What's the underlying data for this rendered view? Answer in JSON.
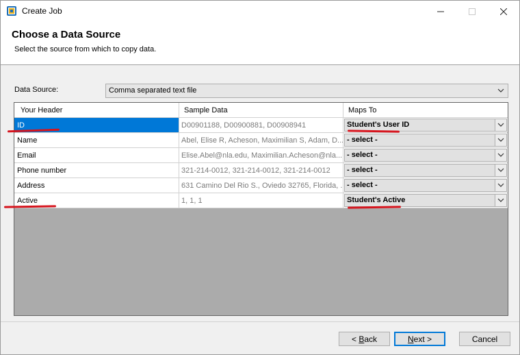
{
  "window": {
    "title": "Create Job",
    "controls": {
      "minimize": "—",
      "maximize": "☐",
      "close": "✕"
    }
  },
  "header": {
    "title": "Choose a Data Source",
    "subtitle": "Select the source from which to copy data."
  },
  "data_source": {
    "label": "Data Source:",
    "value": "Comma separated text file"
  },
  "grid": {
    "columns": [
      "Your Header",
      "Sample Data",
      "Maps To"
    ],
    "rows": [
      {
        "header": "ID",
        "sample": "D00901188, D00900881, D00908941",
        "maps_to": "Student's User ID",
        "selected": true
      },
      {
        "header": "Name",
        "sample": "Abel, Elise R, Acheson, Maximilian S, Adam, D...",
        "maps_to": "- select -"
      },
      {
        "header": "Email",
        "sample": "Elise.Abel@nla.edu, Maximilian.Acheson@nla....",
        "maps_to": "- select -"
      },
      {
        "header": "Phone number",
        "sample": "321-214-0012, 321-214-0012, 321-214-0012",
        "maps_to": "- select -"
      },
      {
        "header": "Address",
        "sample": "631 Camino Del Rio S., Oviedo 32765, Florida, ...",
        "maps_to": "- select -"
      },
      {
        "header": "Active",
        "sample": "1, 1, 1",
        "maps_to": "Student's Active"
      }
    ]
  },
  "buttons": {
    "back_prefix": "< ",
    "back_accel": "B",
    "back_rest": "ack",
    "next_accel": "N",
    "next_rest": "ext >",
    "cancel": "Cancel"
  },
  "colors": {
    "selection": "#0078d7",
    "annotation": "#d6141d",
    "grid_background": "#ababab"
  }
}
